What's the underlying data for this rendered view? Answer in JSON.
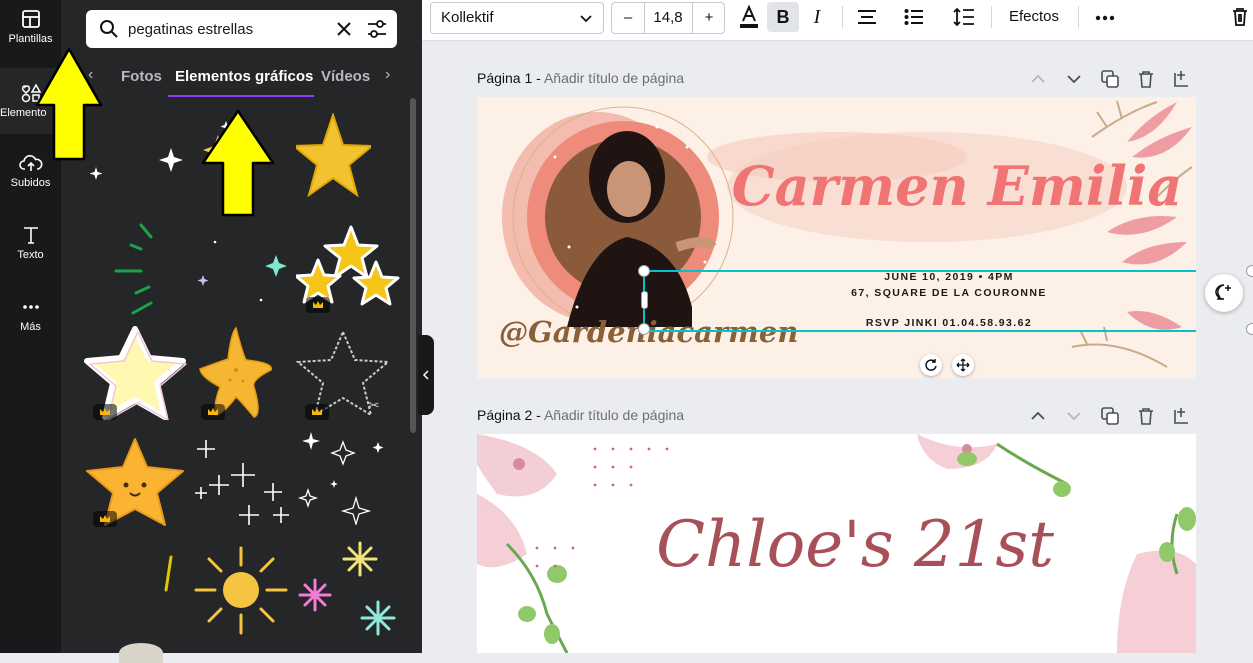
{
  "rail": {
    "items": [
      {
        "label": "Plantillas",
        "icon": "templates-icon"
      },
      {
        "label": "Elemento",
        "icon": "elements-icon"
      },
      {
        "label": "Subidos",
        "icon": "upload-icon"
      },
      {
        "label": "Texto",
        "icon": "text-icon"
      },
      {
        "label": "Más",
        "icon": "more-icon"
      }
    ]
  },
  "search": {
    "value": "pegatinas estrellas"
  },
  "tabs": [
    {
      "label": "Fotos"
    },
    {
      "label": "Elementos gráficos"
    },
    {
      "label": "Vídeos"
    }
  ],
  "toolbar": {
    "font": "Kollektif",
    "font_size": "14,8",
    "effects_label": "Efectos",
    "minus": "–",
    "plus": "+"
  },
  "pages": [
    {
      "label": "Página 1 -",
      "subtitle": "Añadir título de página"
    },
    {
      "label": "Página 2 -",
      "subtitle": "Añadir título de página"
    }
  ],
  "page1": {
    "title": "Carmen Emilia",
    "line1": "JUNE 10, 2019  • 4PM",
    "line2": "67, SQUARE DE LA COURONNE",
    "line3": "RSVP JINKI 01.04.58.93.62",
    "handle_text": "@Gardeniacarmen"
  },
  "page2": {
    "title": "Chloe's 21st"
  },
  "colors": {
    "accent": "#8b3dff",
    "selection": "#00c4cc",
    "annotation": "#ffff00",
    "title_pink": "#f07474",
    "chloe": "#a8505a"
  }
}
